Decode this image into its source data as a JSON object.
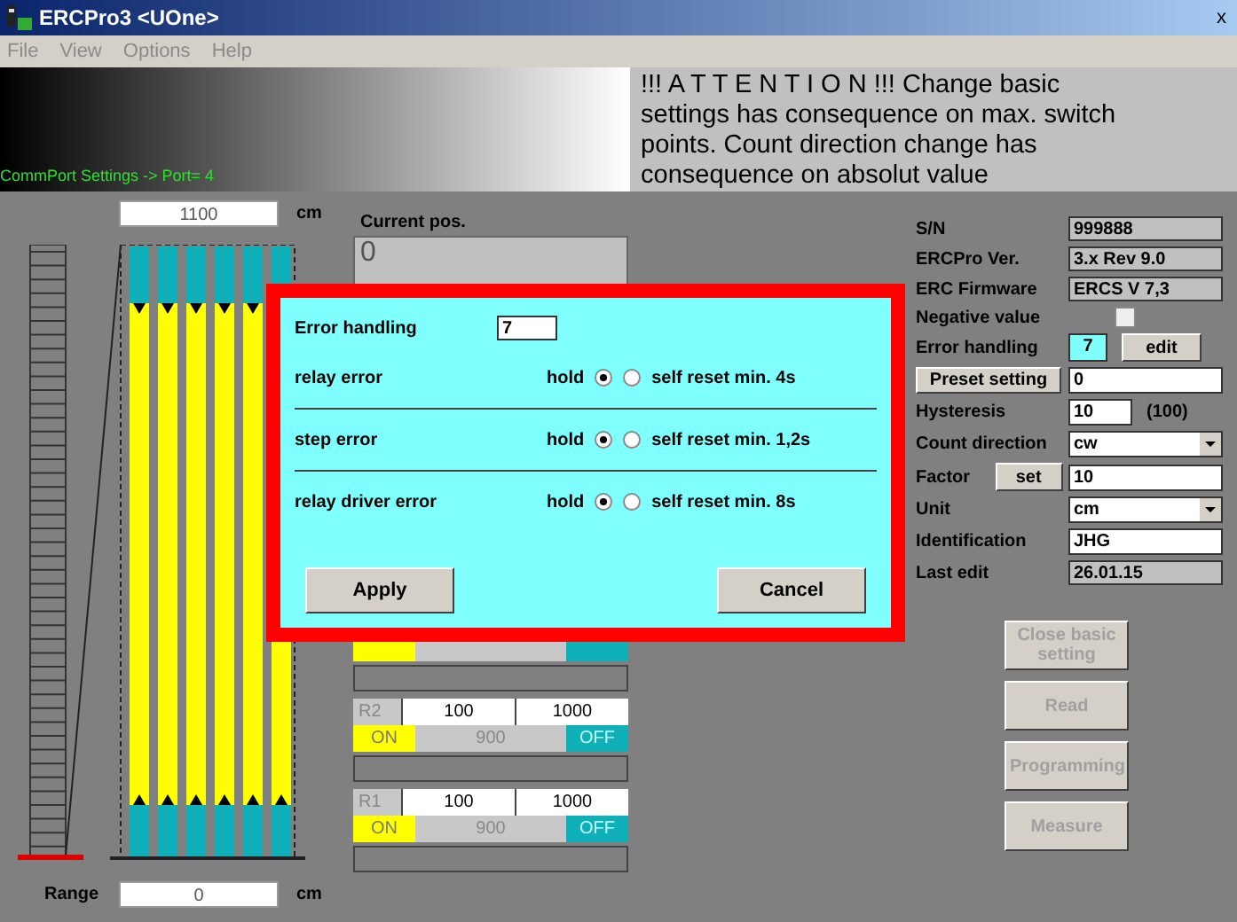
{
  "window": {
    "title": "ERCPro3 <UOne>",
    "close": "x"
  },
  "menu": [
    {
      "label": "File",
      "disabled": true
    },
    {
      "label": "View",
      "disabled": true
    },
    {
      "label": "Options",
      "disabled": true
    },
    {
      "label": "Help",
      "disabled": true
    }
  ],
  "header": {
    "port_status": "CommPort Settings -> Port= 4",
    "attention": "!!! A T T E N T I O N !!!   Change basic settings has consequence on max. switch points. Count direction change has consequence on absolut value"
  },
  "range": {
    "top_value": "1100",
    "top_unit": "cm",
    "label": "Range",
    "bottom_value": "0",
    "bottom_unit": "cm"
  },
  "current_pos": {
    "label": "Current pos.",
    "value": "0"
  },
  "relays": [
    {
      "kind": "partial"
    },
    {
      "kind": "full",
      "name": "R2",
      "from": "100",
      "to": "1000",
      "on": "ON",
      "span": "900",
      "off": "OFF"
    },
    {
      "kind": "full",
      "name": "R1",
      "from": "100",
      "to": "1000",
      "on": "ON",
      "span": "900",
      "off": "OFF"
    }
  ],
  "settings": [
    {
      "kind": "readonly",
      "label": "S/N",
      "value": "999888"
    },
    {
      "kind": "readonly",
      "label": "ERCPro Ver.",
      "value": "3.x Rev 9.0"
    },
    {
      "kind": "readonly",
      "label": "ERC Firmware",
      "value": "ERCS V 7,3"
    },
    {
      "kind": "checkbox",
      "label": "Negative value",
      "checked": false
    },
    {
      "kind": "error",
      "label": "Error handling",
      "value": "7",
      "button": "edit"
    },
    {
      "kind": "preset",
      "button": "Preset setting",
      "value": "0"
    },
    {
      "kind": "hysteresis",
      "label": "Hysteresis",
      "value": "10",
      "note": "(100)"
    },
    {
      "kind": "dropdown",
      "label": "Count direction",
      "value": "cw"
    },
    {
      "kind": "factor",
      "label": "Factor",
      "button": "set",
      "value": "10"
    },
    {
      "kind": "dropdown",
      "label": "Unit",
      "value": "cm"
    },
    {
      "kind": "input",
      "label": "Identification",
      "value": "JHG"
    },
    {
      "kind": "readonly",
      "label": "Last edit",
      "value": "26.01.15"
    }
  ],
  "actions": [
    {
      "label": "Close basic setting",
      "disabled": true
    },
    {
      "label": "Read",
      "disabled": true
    },
    {
      "label": "Programming",
      "disabled": true
    },
    {
      "label": "Measure",
      "disabled": true
    }
  ],
  "dialog": {
    "label": "Error handling",
    "value": "7",
    "errors": [
      {
        "label": "relay error",
        "options": [
          {
            "label": "hold",
            "selected": true
          },
          {
            "label": "self reset min. 4s",
            "selected": false
          }
        ]
      },
      {
        "label": "step error",
        "options": [
          {
            "label": "hold",
            "selected": true
          },
          {
            "label": "self reset min. 1,2s",
            "selected": false
          }
        ]
      },
      {
        "label": "relay driver error",
        "options": [
          {
            "label": "hold",
            "selected": true
          },
          {
            "label": "self reset min. 8s",
            "selected": false
          }
        ]
      }
    ],
    "apply": "Apply",
    "cancel": "Cancel"
  }
}
